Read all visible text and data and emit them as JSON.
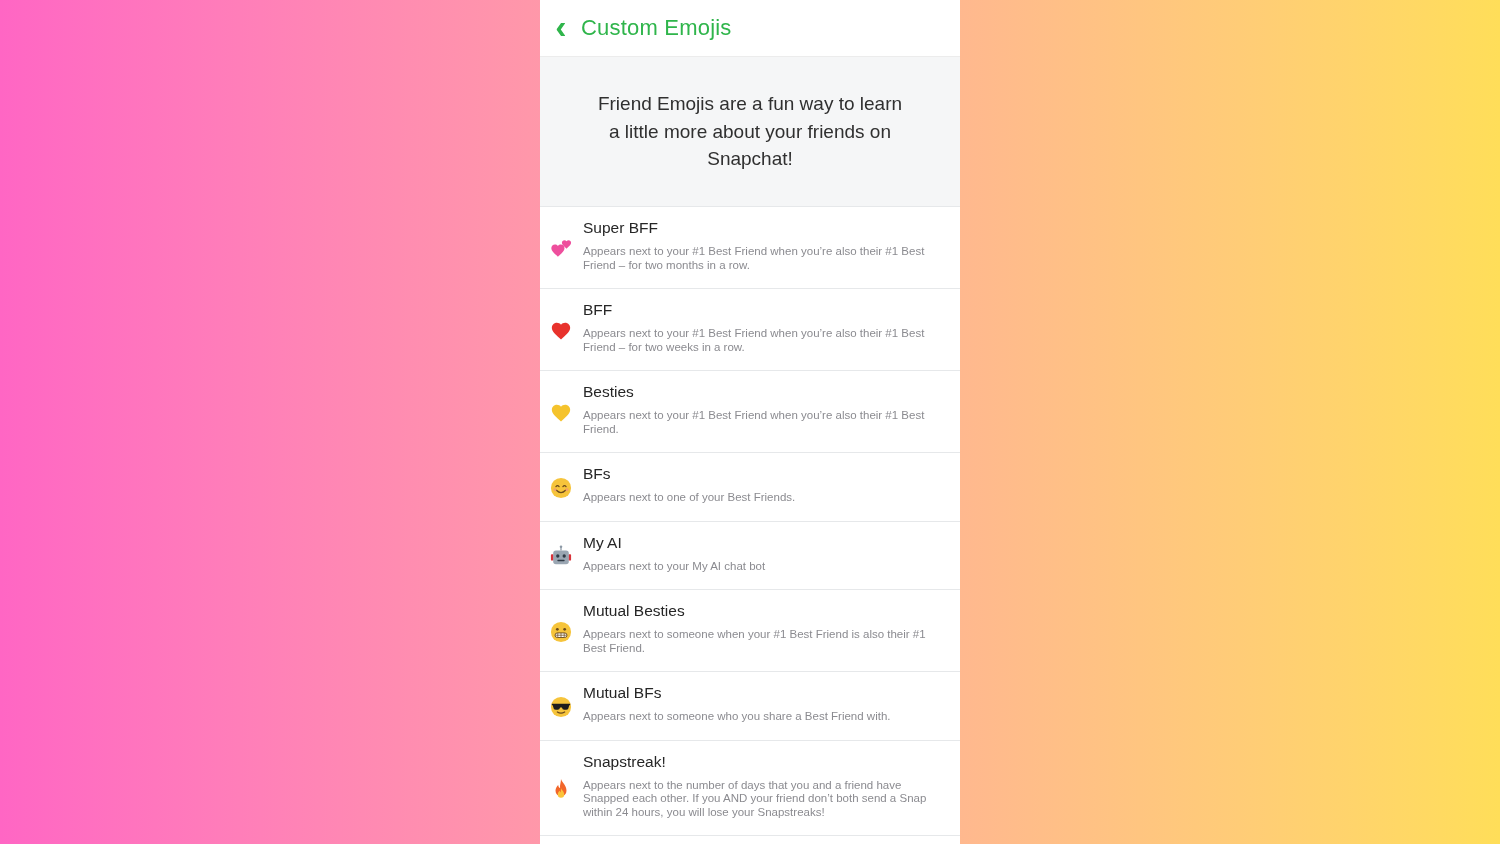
{
  "header": {
    "back": "‹",
    "title": "Custom Emojis"
  },
  "intro": "Friend Emojis are a fun way to learn a little more about your friends on Snapchat!",
  "emojis": [
    {
      "kind": "hearts",
      "color": "#ee4f9d",
      "title": "Super BFF",
      "description": "Appears next to your #1 Best Friend when you’re also their #1 Best Friend – for two months in a row."
    },
    {
      "kind": "heart",
      "color": "#e8322c",
      "title": "BFF",
      "description": "Appears next to your #1 Best Friend when you’re also their #1 Best Friend – for two weeks in a row."
    },
    {
      "kind": "heart",
      "color": "#f5c32c",
      "title": "Besties",
      "description": "Appears next to your #1 Best Friend when you’re also their #1 Best Friend."
    },
    {
      "kind": "smile",
      "title": "BFs",
      "description": "Appears next to one of your Best Friends."
    },
    {
      "kind": "robot",
      "title": "My AI",
      "description": "Appears next to your My AI chat bot"
    },
    {
      "kind": "grimace",
      "title": "Mutual Besties",
      "description": "Appears next to someone when your #1 Best Friend is also their #1 Best Friend."
    },
    {
      "kind": "cool",
      "title": "Mutual BFs",
      "description": "Appears next to someone who you share a Best Friend with."
    },
    {
      "kind": "fire",
      "title": "Snapstreak!",
      "description": "Appears next to the number of days that you and a friend have Snapped each other. If you AND your friend don’t both send a Snap within 24 hours, you will lose your Snapstreaks!"
    }
  ]
}
